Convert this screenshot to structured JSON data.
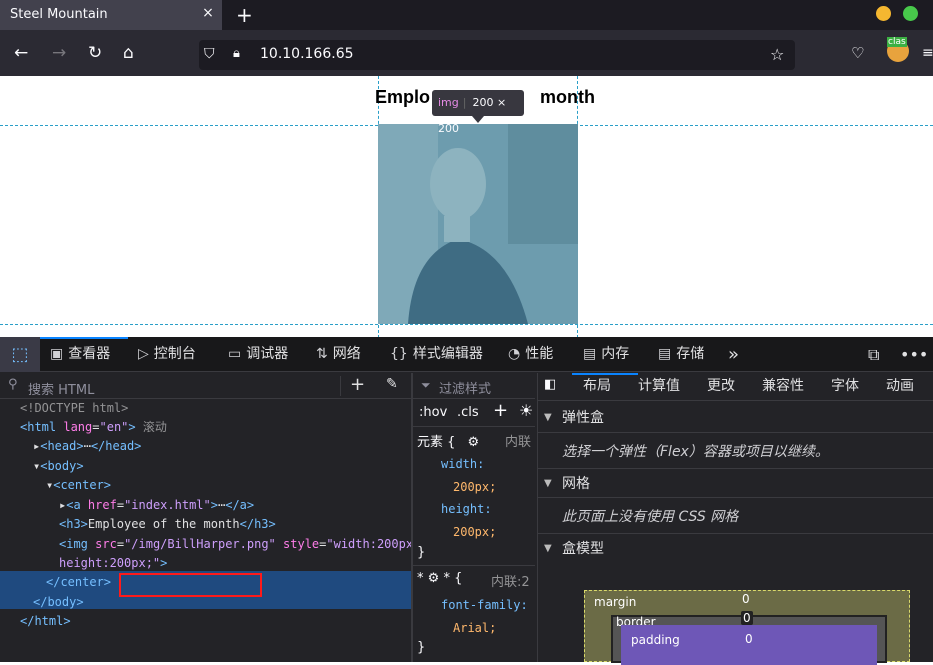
{
  "browser": {
    "tab_title": "Steel Mountain",
    "tab_close": "×",
    "new_tab": "+",
    "url": "10.10.166.65",
    "extension_badge": "clas"
  },
  "page": {
    "heading_left": "Emplo",
    "heading_right": "month",
    "tooltip_tag": "img",
    "tooltip_size": "200 × 200"
  },
  "devtools": {
    "tabs": [
      {
        "icon": "▣",
        "label": "查看器"
      },
      {
        "icon": "▷",
        "label": "控制台"
      },
      {
        "icon": "▭",
        "label": "调试器"
      },
      {
        "icon": "⇅",
        "label": "网络"
      },
      {
        "icon": "{}",
        "label": "样式编辑器"
      },
      {
        "icon": "◔",
        "label": "性能"
      },
      {
        "icon": "▤",
        "label": "内存"
      },
      {
        "icon": "▤",
        "label": "存储"
      }
    ],
    "more": "»",
    "search_placeholder": "搜索 HTML",
    "tree": [
      {
        "indent": 0,
        "html": "<span class='gray'>&lt;!DOCTYPE html&gt;</span>"
      },
      {
        "indent": 0,
        "html": "<span class='tag'>&lt;html</span> <span class='attr'>lang</span>=<span class='val'>\"en\"</span><span class='tag'>&gt;</span> <span class='gray'>滚动</span>"
      },
      {
        "indent": 1,
        "html": "▸<span class='tag'>&lt;head&gt;</span>⋯<span class='tag'>&lt;/head&gt;</span>"
      },
      {
        "indent": 1,
        "html": "▾<span class='tag'>&lt;body&gt;</span>"
      },
      {
        "indent": 2,
        "html": "▾<span class='tag'>&lt;center&gt;</span>"
      },
      {
        "indent": 3,
        "html": "▸<span class='tag'>&lt;a</span> <span class='attr'>href</span>=<span class='val'>\"index.html\"</span><span class='tag'>&gt;</span>⋯<span class='tag'>&lt;/a&gt;</span>"
      },
      {
        "indent": 3,
        "html": "<span class='tag'>&lt;h3&gt;</span>Employee of the month<span class='tag'>&lt;/h3&gt;</span>"
      },
      {
        "indent": 3,
        "html": "<span class='tag'>&lt;img</span> <span class='attr'>src</span>=<span class='val'>\"/img/BillHarper.png\"</span> <span class='attr'>style</span>=<span class='val'>\"width:200px;</span>"
      },
      {
        "indent": 3,
        "html": "<span class='val'>height:200px;\"</span><span class='tag'>&gt;</span>"
      },
      {
        "indent": 2,
        "html": "<span class='tag'>&lt;/center&gt;</span>"
      },
      {
        "indent": 1,
        "html": "<span class='tag'>&lt;/body&gt;</span>"
      },
      {
        "indent": 0,
        "html": "<span class='tag'>&lt;/html&gt;</span>"
      }
    ],
    "rules": {
      "filter_placeholder": "过滤样式",
      "hov": ":hov",
      "cls": ".cls",
      "element_label": "元素 {",
      "inline": "内联",
      "props": [
        "width:",
        "200px;",
        "height:",
        "200px;"
      ],
      "close": "}",
      "star_label": "* {",
      "inline2": "内联:2",
      "props2": [
        "font-family:",
        "Arial;"
      ]
    },
    "layout": {
      "tabs": [
        "布局",
        "计算值",
        "更改",
        "兼容性",
        "字体",
        "动画"
      ],
      "flex_title": "弹性盒",
      "flex_note": "选择一个弹性（Flex）容器或项目以继续。",
      "grid_title": "网格",
      "grid_note": "此页面上没有使用 CSS 网格",
      "box_title": "盒模型",
      "margin_label": "margin",
      "margin_value": "0",
      "border_label": "border",
      "border_value": "0",
      "padding_label": "padding",
      "padding_value": "0"
    }
  }
}
